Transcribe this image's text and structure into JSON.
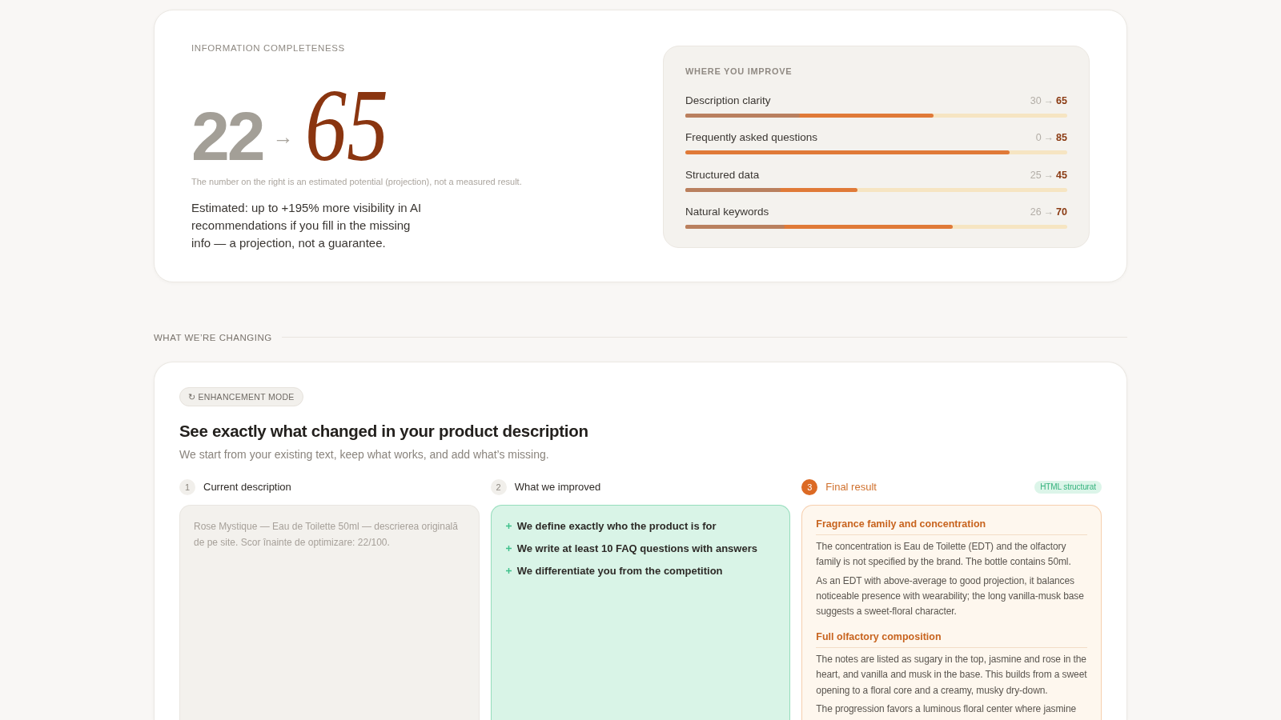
{
  "completeness": {
    "label": "INFORMATION COMPLETENESS",
    "score_before": "22",
    "arrow": "→",
    "score_after": "65",
    "note": "The number on the right is an estimated potential (projection), not a measured result.",
    "estimate": "Estimated: up to +195% more visibility in AI recommendations if you fill in the missing info — a projection, not a guarantee."
  },
  "improvements": {
    "label": "WHERE YOU IMPROVE",
    "rows": [
      {
        "label": "Description clarity",
        "before": "30",
        "arrow": "→",
        "after": "65",
        "before_bar": {
          "level": 0.3
        },
        "after_bar": {
          "level": 0.65
        }
      },
      {
        "label": "Frequently asked questions",
        "before": "0",
        "arrow": "→",
        "after": "85",
        "after_bar": {
          "level": 0.85
        }
      },
      {
        "label": "Structured data",
        "before": "25",
        "arrow": "→",
        "after": "45",
        "before_bar": {
          "level": 0.25
        },
        "after_bar": {
          "level": 0.45
        }
      },
      {
        "label": "Natural keywords",
        "before": "26",
        "arrow": "→",
        "after": "70",
        "before_bar": {
          "level": 0.26
        },
        "after_bar": {
          "level": 0.7
        }
      }
    ]
  },
  "section": {
    "title": "WHAT WE’RE CHANGING"
  },
  "comparison": {
    "badge": "↻ ENHANCEMENT MODE",
    "title": "See exactly what changed in your product description",
    "subtitle": "We start from your existing text, keep what works, and add what’s missing.",
    "columns": [
      {
        "kind": "original",
        "step": "1",
        "title": "Current description",
        "text": "Rose Mystique — Eau de Toilette 50ml — descrierea originală de pe site. Scor înainte de optimizare: 22/100."
      },
      {
        "kind": "changes",
        "step": "2",
        "title": "What we improved",
        "items": [
          "We define exactly who the product is for",
          "We write at least 10 FAQ questions with answers",
          "We differentiate you from the competition"
        ]
      },
      {
        "kind": "result",
        "step": "3",
        "title": "Final result",
        "tag": "HTML structurat",
        "sections": [
          {
            "heading": "Fragrance family and concentration",
            "paragraphs": [
              "The concentration is Eau de Toilette (EDT) and the olfactory family is not specified by the brand. The bottle contains 50ml.",
              "As an EDT with above-average to good projection, it balances noticeable presence with wearability; the long vanilla-musk base suggests a sweet-floral character."
            ]
          },
          {
            "heading": "Full olfactory composition",
            "paragraphs": [
              "The notes are listed as sugary in the top, jasmine and rose in the heart, and vanilla and musk in the base. This builds from a sweet opening to a floral core and a creamy, musky dry-down.",
              "The progression favors a luminous floral center where jasmine"
            ]
          }
        ]
      }
    ]
  }
}
